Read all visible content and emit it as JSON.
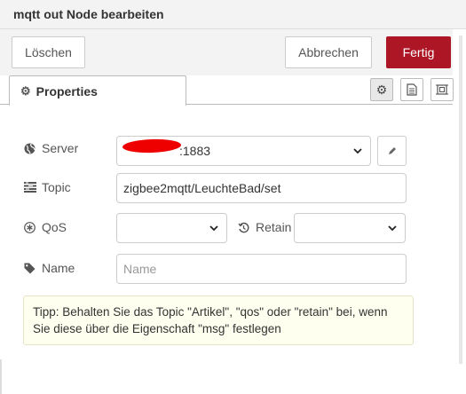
{
  "window": {
    "title": "mqtt out Node bearbeiten"
  },
  "toolbar": {
    "delete_label": "Löschen",
    "cancel_label": "Abbrechen",
    "done_label": "Fertig"
  },
  "tabs": {
    "properties_label": "Properties",
    "properties_icon": "gear-icon",
    "buttons": [
      "gear-icon",
      "document-icon",
      "frame-icon"
    ]
  },
  "form": {
    "server": {
      "label": "Server",
      "icon": "globe-icon",
      "value": ":1883"
    },
    "topic": {
      "label": "Topic",
      "icon": "tasks-icon",
      "value": "zigbee2mqtt/LeuchteBad/set"
    },
    "qos": {
      "label": "QoS",
      "icon": "asterisk-circle-icon",
      "value": ""
    },
    "retain": {
      "label": "Retain",
      "icon": "history-icon",
      "value": ""
    },
    "name": {
      "label": "Name",
      "icon": "tag-icon",
      "placeholder": "Name",
      "value": ""
    },
    "tip": "Tipp: Behalten Sie das Topic \"Artikel\", \"qos\" oder \"retain\" bei, wenn Sie diese über die Eigenschaft \"msg\" festlegen"
  },
  "colors": {
    "primary": "#ad1625",
    "tip_background": "#ffffef",
    "redaction": "#ee0000"
  }
}
